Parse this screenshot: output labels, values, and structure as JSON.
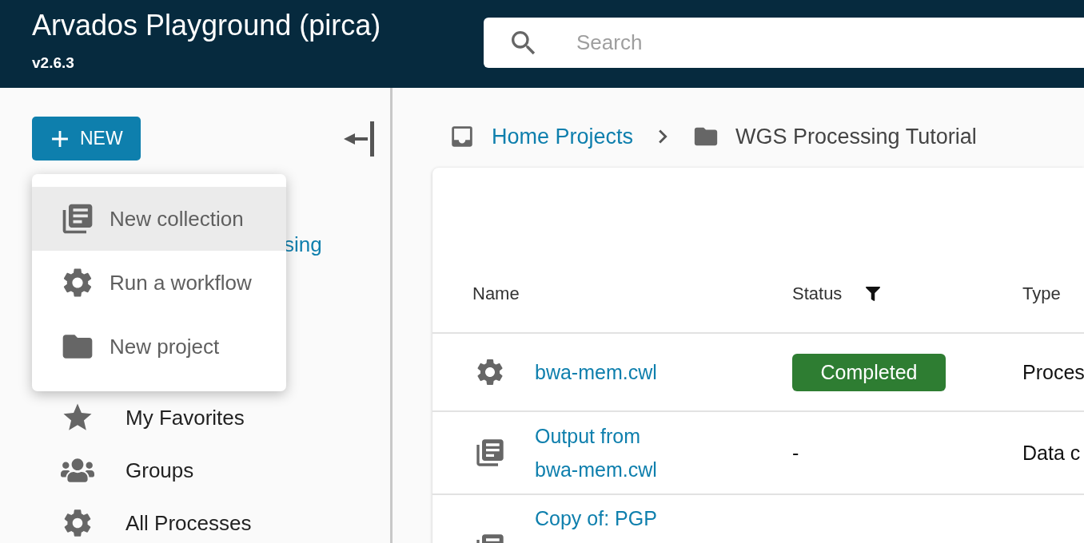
{
  "header": {
    "title": "Arvados Playground (pirca)",
    "version": "v2.6.3",
    "search": {
      "placeholder": "Search"
    }
  },
  "sidebar": {
    "new_button": "NEW",
    "tree_item": "sing",
    "items": [
      {
        "label": "My Favorites"
      },
      {
        "label": "Groups"
      },
      {
        "label": "All Processes"
      }
    ]
  },
  "new_menu": {
    "items": [
      {
        "label": "New collection",
        "selected": true
      },
      {
        "label": "Run a workflow",
        "selected": false
      },
      {
        "label": "New project",
        "selected": false
      }
    ]
  },
  "breadcrumbs": [
    {
      "label": "Home Projects",
      "kind": "link"
    },
    {
      "label": "WGS Processing Tutorial",
      "kind": "current"
    }
  ],
  "table": {
    "columns": [
      {
        "label": "Name",
        "filter": false
      },
      {
        "label": "Status",
        "filter": true
      },
      {
        "label": "Type",
        "filter": false
      }
    ],
    "rows": [
      {
        "name": "bwa-mem.cwl",
        "status": {
          "kind": "badge",
          "text": "Completed"
        },
        "type": "Proces"
      },
      {
        "name": "Output from bwa-mem.cwl",
        "status": {
          "kind": "plain",
          "text": "-"
        },
        "type": "Data c"
      },
      {
        "name": "Copy of: PGP"
      }
    ]
  }
}
